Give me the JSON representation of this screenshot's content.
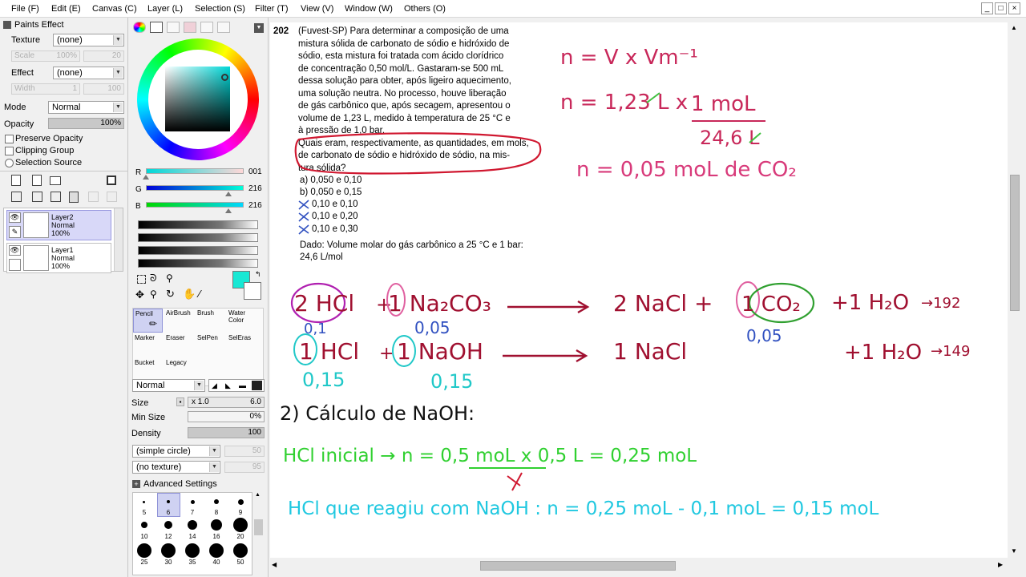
{
  "menu": {
    "items": [
      "File (F)",
      "Edit (E)",
      "Canvas (C)",
      "Layer (L)",
      "Selection (S)",
      "Filter (T)",
      "View (V)",
      "Window (W)",
      "Others (O)"
    ],
    "window_buttons": [
      "_",
      "□",
      "×"
    ]
  },
  "props": {
    "paints_effect": "Paints Effect",
    "texture_label": "Texture",
    "texture_value": "(none)",
    "scale_label": "Scale",
    "scale_value": "100%",
    "scale_num": "20",
    "effect_label": "Effect",
    "effect_value": "(none)",
    "width_label": "Width",
    "width_value": "1",
    "width_num": "100",
    "mode_label": "Mode",
    "mode_value": "Normal",
    "opacity_label": "Opacity",
    "opacity_value": "100%",
    "preserve_opacity": "Preserve Opacity",
    "clipping_group": "Clipping Group",
    "selection_source": "Selection Source"
  },
  "layers": [
    {
      "name": "Layer2",
      "mode": "Normal",
      "opacity": "100%"
    },
    {
      "name": "Layer1",
      "mode": "Normal",
      "opacity": "100%"
    }
  ],
  "color": {
    "r": "001",
    "g": "216",
    "b": "216",
    "current": "#17e8d4",
    "r_fraction": 0.004,
    "g_fraction": 0.847,
    "b_fraction": 0.847
  },
  "tools": [
    {
      "label": "Pencil"
    },
    {
      "label": "AirBrush"
    },
    {
      "label": "Brush"
    },
    {
      "label": "Water Color"
    },
    {
      "label": "Marker"
    },
    {
      "label": "Eraser"
    },
    {
      "label": "SelPen"
    },
    {
      "label": "SelEras"
    },
    {
      "label": "Bucket"
    },
    {
      "label": "Legacy"
    }
  ],
  "brush": {
    "blend": "Normal",
    "size_label": "Size",
    "size_mult": "x 1.0",
    "size_value": "6.0",
    "min_size_label": "Min Size",
    "min_size_value": "0%",
    "density_label": "Density",
    "density_value": "100",
    "shape": "(simple circle)",
    "shape_num": "50",
    "texture": "(no texture)",
    "texture_num": "95",
    "advanced": "Advanced Settings",
    "sizes": [
      "5",
      "6",
      "7",
      "8",
      "9",
      "10",
      "12",
      "14",
      "16",
      "20",
      "25",
      "30",
      "35",
      "40",
      "50"
    ]
  },
  "question": {
    "number": "202",
    "lines": [
      "(Fuvest-SP) Para determinar a composição de uma",
      "mistura sólida de carbonato de sódio e hidróxido de",
      "sódio, esta mistura foi tratada com ácido clorídrico",
      "de concentração 0,50 mol/L. Gastaram-se 500 mL",
      "dessa solução para obter, após ligeiro aquecimento,",
      "uma solução neutra. No processo, houve liberação",
      "de gás carbônico que, após secagem, apresentou o",
      "volume de 1,23 L, medido à temperatura de 25 °C e",
      "à pressão de 1,0 bar.",
      "Quais eram, respectivamente, as quantidades, em mols,",
      "de carbonato de sódio e hidróxido de sódio, na mis-",
      "tura sólida?"
    ],
    "options": [
      "a)  0,050 e 0,10",
      "b)  0,050 e 0,15",
      "0,10 e 0,10",
      "0,10 e 0,20",
      "0,10 e 0,30"
    ],
    "dado": [
      "Dado: Volume molar do gás carbônico a 25 °C e 1 bar:",
      "24,6 L/mol"
    ]
  },
  "handwriting": {
    "f1": "n = V x Vm⁻¹",
    "f2a": "n = 1,23 L x",
    "f2b": "1 moL",
    "f2c": "24,6 L",
    "f3": "n = 0,05 moL de CO₂",
    "eq1_hcl": "2 HCl",
    "eq1_plus": "+",
    "eq1_na2co3": "1 Na₂CO₃",
    "eq1_products": "2 NaCl  +",
    "eq1_co2": "1 CO₂",
    "eq1_water": "+1 H₂O",
    "eq1_note": "→192",
    "eq1_hcl_n": "0,1",
    "eq1_na2co3_n": "0,05",
    "eq1_co2_n": "0,05",
    "eq2_hcl": "1 HCl",
    "eq2_plus": "+",
    "eq2_naoh": "1 NaOH",
    "eq2_nacl": "1 NaCl",
    "eq2_water": "+1 H₂O",
    "eq2_note": "→149",
    "eq2_hcl_n": "0,15",
    "eq2_naoh_n": "0,15",
    "step2": "2) Cálculo de NaOH:",
    "hcl_initial_a": "HCl inicial →  n = 0,5 moL x 0,5 L = 0,25 moL",
    "hcl_react": "HCl que reagiu com NaOH :  n = 0,25 moL - 0,1 moL = 0,15 moL"
  }
}
